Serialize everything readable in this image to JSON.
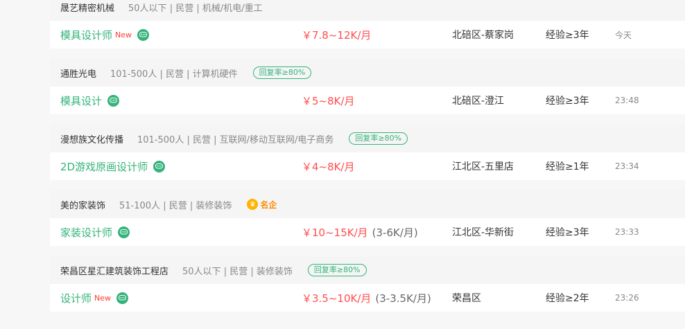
{
  "jobs": [
    {
      "company": "晟艺精密机械",
      "meta": "50人以下 | 民营 | 机械/机电/重工",
      "reply_rate": "",
      "famous": "",
      "title": "模具设计师",
      "new_tag": "New",
      "salary": "￥7.8~12K/月",
      "salary_extra": "",
      "location": "北碚区-蔡家岗",
      "experience": "经验≥3年",
      "time": "今天"
    },
    {
      "company": "通胜光电",
      "meta": "101-500人 | 民营 | 计算机硬件",
      "reply_rate": "回复率≥80%",
      "famous": "",
      "title": "模具设计",
      "new_tag": "",
      "salary": "￥5~8K/月",
      "salary_extra": "",
      "location": "北碚区-澄江",
      "experience": "经验≥3年",
      "time": "23:48"
    },
    {
      "company": "漫想族文化传播",
      "meta": "101-500人 | 民营 | 互联网/移动互联网/电子商务",
      "reply_rate": "回复率≥80%",
      "famous": "",
      "title": "2D游戏原画设计师",
      "new_tag": "",
      "salary": "￥4~8K/月",
      "salary_extra": "",
      "location": "江北区-五里店",
      "experience": "经验≥1年",
      "time": "23:34"
    },
    {
      "company": "美的家装饰",
      "meta": "51-100人 | 民营 | 装修装饰",
      "reply_rate": "",
      "famous": "名企",
      "title": "家装设计师",
      "new_tag": "",
      "salary": "￥10~15K/月",
      "salary_extra": "(3-6K/月)",
      "location": "江北区-华新街",
      "experience": "经验≥3年",
      "time": "23:33"
    },
    {
      "company": "荣昌区星汇建筑装饰工程店",
      "meta": "50人以下 | 民营 | 装修装饰",
      "reply_rate": "回复率≥80%",
      "famous": "",
      "title": "设计师",
      "new_tag": "New",
      "salary": "￥3.5~10K/月",
      "salary_extra": "(3-3.5K/月)",
      "location": "荣昌区",
      "experience": "经验≥2年",
      "time": "23:26"
    }
  ]
}
